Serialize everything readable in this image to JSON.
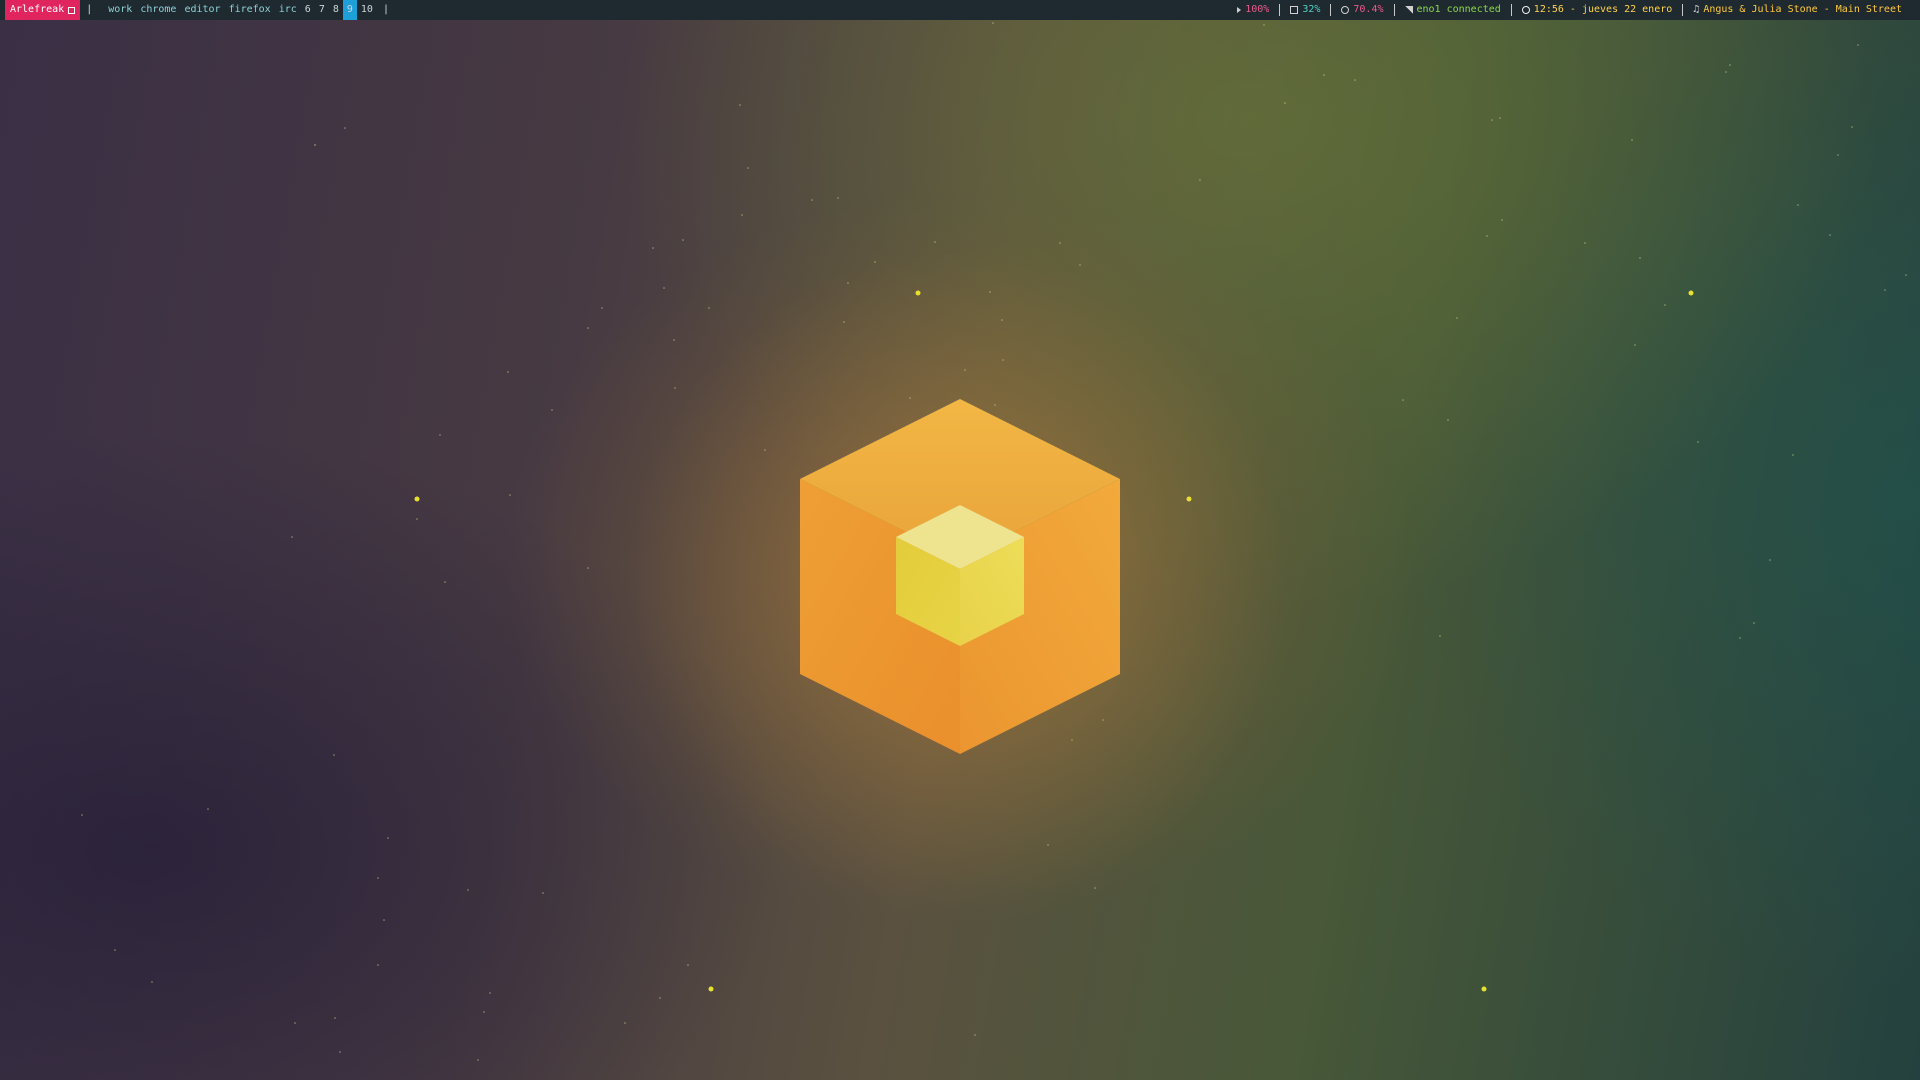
{
  "bar": {
    "host": "Arlefreak",
    "workspaces": [
      {
        "label": "work",
        "active": false
      },
      {
        "label": "chrome",
        "active": false
      },
      {
        "label": "editor",
        "active": false
      },
      {
        "label": "firefox",
        "active": false
      },
      {
        "label": "irc",
        "active": false
      },
      {
        "label": "6",
        "active": false
      },
      {
        "label": "7",
        "active": false
      },
      {
        "label": "8",
        "active": false
      },
      {
        "label": "9",
        "active": true
      },
      {
        "label": "10",
        "active": false
      }
    ],
    "status": {
      "volume": "100%",
      "cpu": "32%",
      "memory": "70.4%",
      "network": "eno1 connected",
      "clock": "12:56 - jueves 22 enero",
      "music": "Angus & Julia Stone - Main Street"
    }
  },
  "colors": {
    "bar_background": "#1f2a30",
    "host_badge": "#e0245e",
    "active_workspace": "#1e9fd8",
    "cube_outer": "#f0a030",
    "cube_inner": "#e8d840"
  },
  "icons": [
    "workspace-grid-icon",
    "speaker-icon",
    "cpu-icon",
    "memory-icon",
    "network-signal-icon",
    "clock-icon",
    "music-note-icon"
  ]
}
